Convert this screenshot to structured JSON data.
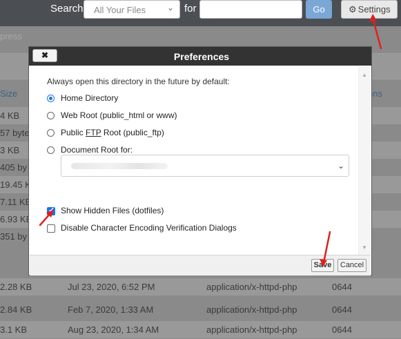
{
  "topbar": {
    "search_label": "Search",
    "scope_value": "All Your Files",
    "for_label": "for",
    "search_value": "",
    "go_label": "Go",
    "settings_label": "Settings"
  },
  "background": {
    "express_text": "press",
    "columns": {
      "size": "Size",
      "permissions": "ons"
    },
    "rows": [
      {
        "size": "4 KB"
      },
      {
        "size": "57 byte"
      },
      {
        "size": "3 KB"
      },
      {
        "size": "405 by"
      },
      {
        "size": "19.45 K"
      },
      {
        "size": "7.11 KB"
      },
      {
        "size": "6.93 KB"
      },
      {
        "size": "351 by"
      },
      {
        "size": "2.28 KB",
        "date": "Jul 23, 2020, 6:52 PM",
        "type": "application/x-httpd-php",
        "perm": "0644"
      },
      {
        "size": "2.84 KB",
        "date": "Feb 7, 2020, 1:33 AM",
        "type": "application/x-httpd-php",
        "perm": "0644"
      },
      {
        "size": "3.1 KB",
        "date": "Aug 23, 2020, 1:34 AM",
        "type": "application/x-httpd-php",
        "perm": "0644"
      }
    ]
  },
  "modal": {
    "title": "Preferences",
    "close_label": "✖",
    "intro": "Always open this directory in the future by default:",
    "options": {
      "home": "Home Directory",
      "web_root": "Web Root (public_html or www)",
      "ftp_pre": "Public ",
      "ftp_u": "FTP",
      "ftp_post": " Root (public_ftp)",
      "docroot": "Document Root for:"
    },
    "selected_option": "Home Directory",
    "checkboxes": {
      "show_hidden": "Show Hidden Files (dotfiles)",
      "show_hidden_checked": true,
      "disable_encoding": "Disable Character Encoding Verification Dialogs",
      "disable_encoding_checked": false
    },
    "save_label": "Save",
    "cancel_label": "Cancel"
  },
  "colors": {
    "accent": "#1a73e8",
    "arrow": "#e02020",
    "title_bar": "#333333"
  },
  "icons": [
    "gear-icon",
    "chevron-down-icon",
    "close-icon",
    "scroll-up-icon",
    "scroll-down-icon",
    "arrow-annotation-icon"
  ]
}
